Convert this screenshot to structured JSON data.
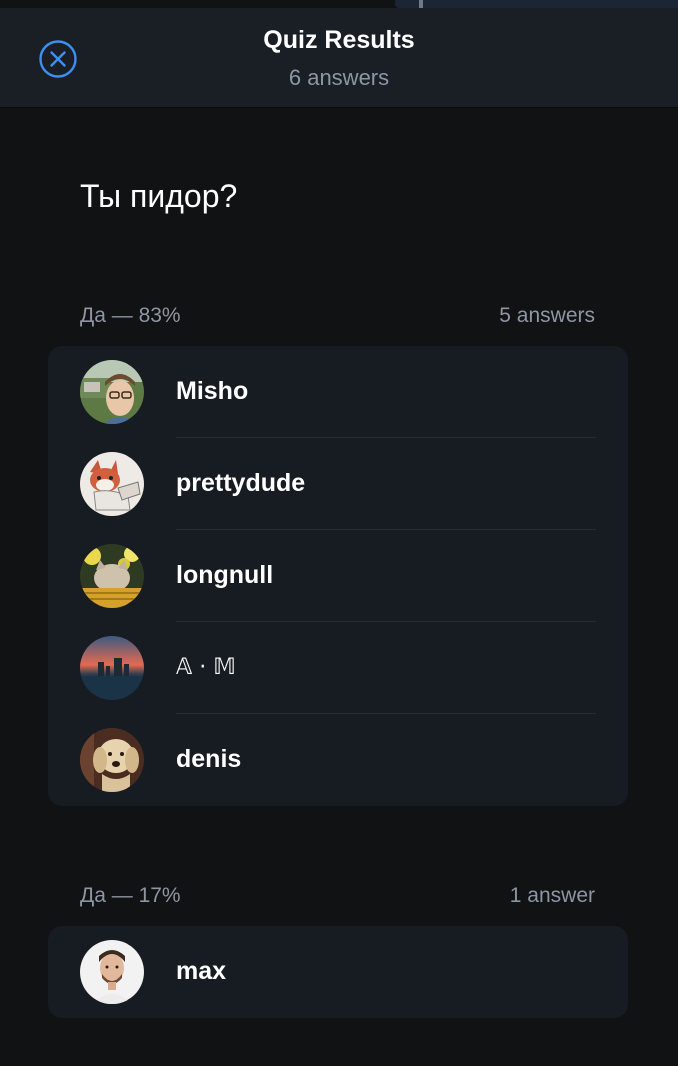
{
  "header": {
    "title": "Quiz Results",
    "subtitle": "6 answers",
    "close_icon": "close-circle-icon"
  },
  "question": "Ты пидор?",
  "sections": [
    {
      "option_label": "Да — 83%",
      "answers_count": "5 answers",
      "voters": [
        {
          "name": "Misho",
          "avatar": "photo-man-glasses"
        },
        {
          "name": "prettydude",
          "avatar": "cartoon-cat"
        },
        {
          "name": "longnull",
          "avatar": "photo-cat-flowers"
        },
        {
          "name": "𝔸 · 𝕄",
          "avatar": "photo-sunset-skyline"
        },
        {
          "name": "denis",
          "avatar": "photo-dog"
        }
      ]
    },
    {
      "option_label": "Да — 17%",
      "answers_count": "1 answer",
      "voters": [
        {
          "name": "max",
          "avatar": "photo-man-portrait"
        }
      ]
    }
  ],
  "colors": {
    "background": "#111213",
    "header_bg": "#1a1f26",
    "card_bg": "#171b22",
    "accent": "#3d8ff5",
    "secondary_text": "#8d96a3"
  }
}
